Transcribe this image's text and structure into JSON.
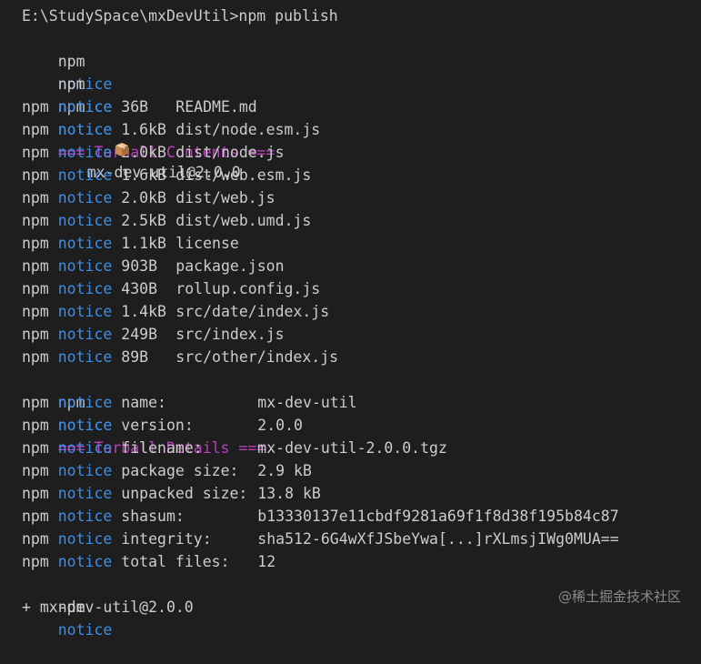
{
  "terminal": {
    "command_line": "E:\\StudySpace\\mxDevUtil>npm publish",
    "npm": "npm",
    "notice": "notice",
    "package_id": "mx-dev-util@2.0.0",
    "contents_header": "=== Tarball Contents ===",
    "files": [
      {
        "size": "36B",
        "path": "README.md"
      },
      {
        "size": "1.6kB",
        "path": "dist/node.esm.js"
      },
      {
        "size": "2.0kB",
        "path": "dist/node.js"
      },
      {
        "size": "1.6kB",
        "path": "dist/web.esm.js"
      },
      {
        "size": "2.0kB",
        "path": "dist/web.js"
      },
      {
        "size": "2.5kB",
        "path": "dist/web.umd.js"
      },
      {
        "size": "1.1kB",
        "path": "license"
      },
      {
        "size": "903B",
        "path": "package.json"
      },
      {
        "size": "430B",
        "path": "rollup.config.js"
      },
      {
        "size": "1.4kB",
        "path": "src/date/index.js"
      },
      {
        "size": "249B",
        "path": "src/index.js"
      },
      {
        "size": "89B",
        "path": "src/other/index.js"
      }
    ],
    "details_header": "=== Tarball Details ===",
    "details": [
      {
        "key": "name:",
        "value": "mx-dev-util"
      },
      {
        "key": "version:",
        "value": "2.0.0"
      },
      {
        "key": "filename:",
        "value": "mx-dev-util-2.0.0.tgz"
      },
      {
        "key": "package size:",
        "value": "2.9 kB"
      },
      {
        "key": "unpacked size:",
        "value": "13.8 kB"
      },
      {
        "key": "shasum:",
        "value": "b13330137e11cbdf9281a69f1f8d38f195b84c87"
      },
      {
        "key": "integrity:",
        "value": "sha512-6G4wXfJSbeYwa[...]rXLmsjIWg0MUA=="
      },
      {
        "key": "total files:",
        "value": "12"
      }
    ],
    "published_line": "+ mx-dev-util@2.0.0",
    "package_icon": "package-icon"
  },
  "watermark": "@稀土掘金技术社区",
  "colors": {
    "background": "#1e1e1e",
    "text": "#cccccc",
    "notice": "#3b8eea",
    "section": "#bc3fbc"
  }
}
